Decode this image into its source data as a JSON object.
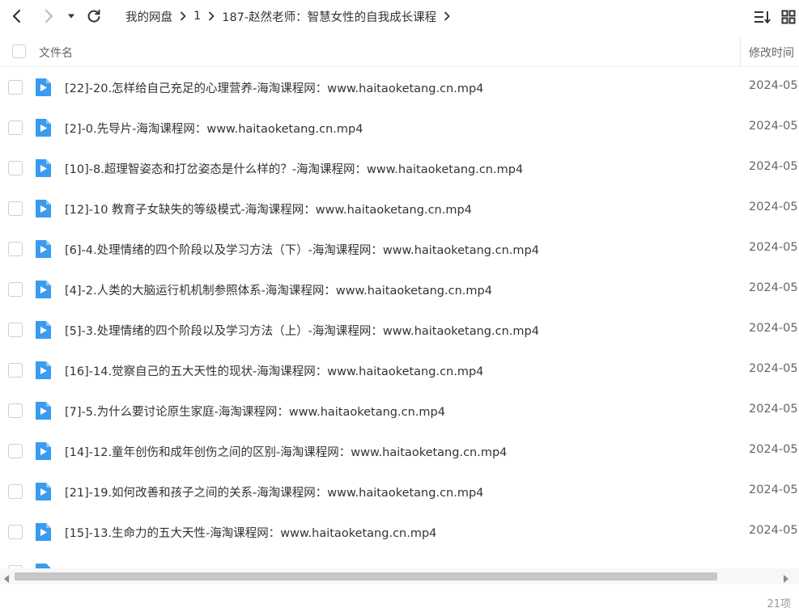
{
  "toolbar": {
    "back_icon": "chevron-left-icon",
    "forward_icon": "chevron-right-icon",
    "dropdown_icon": "caret-down-icon",
    "refresh_icon": "refresh-icon",
    "sort_icon": "sort-list-icon",
    "view_icon": "grid-view-icon"
  },
  "breadcrumb": [
    "我的网盘",
    "1",
    "187-赵然老师：智慧女性的自我成长课程"
  ],
  "header": {
    "name_label": "文件名",
    "time_label": "修改时间"
  },
  "files": [
    {
      "name": "[22]-20.怎样给自己充足的心理营养-海淘课程网：www.haitaoketang.cn.mp4",
      "time": "2024-05"
    },
    {
      "name": "[2]-0.先导片-海淘课程网：www.haitaoketang.cn.mp4",
      "time": "2024-05"
    },
    {
      "name": "[10]-8.超理智姿态和打岔姿态是什么样的？-海淘课程网：www.haitaoketang.cn.mp4",
      "time": "2024-05"
    },
    {
      "name": "[12]-10 教育子女缺失的等级模式-海淘课程网：www.haitaoketang.cn.mp4",
      "time": "2024-05"
    },
    {
      "name": "[6]-4.处理情绪的四个阶段以及学习方法（下）-海淘课程网：www.haitaoketang.cn.mp4",
      "time": "2024-05"
    },
    {
      "name": "[4]-2.人类的大脑运行机机制参照体系-海淘课程网：www.haitaoketang.cn.mp4",
      "time": "2024-05"
    },
    {
      "name": "[5]-3.处理情绪的四个阶段以及学习方法（上）-海淘课程网：www.haitaoketang.cn.mp4",
      "time": "2024-05"
    },
    {
      "name": "[16]-14.觉察自己的五大天性的现状-海淘课程网：www.haitaoketang.cn.mp4",
      "time": "2024-05"
    },
    {
      "name": "[7]-5.为什么要讨论原生家庭-海淘课程网：www.haitaoketang.cn.mp4",
      "time": "2024-05"
    },
    {
      "name": "[14]-12.童年创伤和成年创伤之间的区别-海淘课程网：www.haitaoketang.cn.mp4",
      "time": "2024-05"
    },
    {
      "name": "[21]-19.如何改善和孩子之间的关系-海淘课程网：www.haitaoketang.cn.mp4",
      "time": "2024-05"
    },
    {
      "name": "[15]-13.生命力的五大天性-海淘课程网：www.haitaoketang.cn.mp4",
      "time": "2024-05"
    }
  ],
  "status": {
    "count": "21项"
  },
  "colors": {
    "file_icon": "#3a9bf0",
    "scroll_thumb": "#c6c6c6"
  }
}
